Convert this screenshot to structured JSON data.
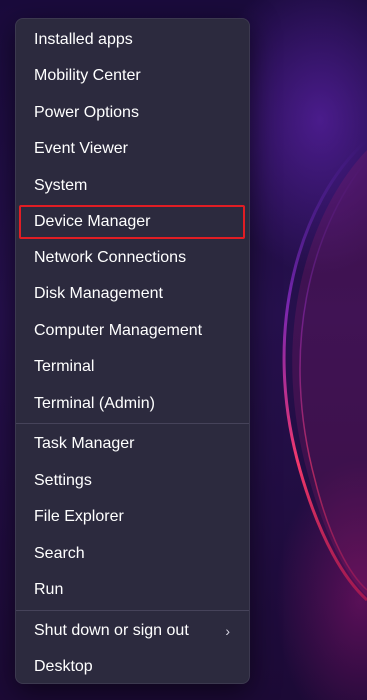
{
  "menu": {
    "group1": [
      {
        "label": "Installed apps"
      },
      {
        "label": "Mobility Center"
      },
      {
        "label": "Power Options"
      },
      {
        "label": "Event Viewer"
      },
      {
        "label": "System"
      },
      {
        "label": "Device Manager"
      },
      {
        "label": "Network Connections"
      },
      {
        "label": "Disk Management"
      },
      {
        "label": "Computer Management"
      },
      {
        "label": "Terminal"
      },
      {
        "label": "Terminal (Admin)"
      }
    ],
    "group2": [
      {
        "label": "Task Manager"
      },
      {
        "label": "Settings"
      },
      {
        "label": "File Explorer"
      },
      {
        "label": "Search"
      },
      {
        "label": "Run"
      }
    ],
    "group3": [
      {
        "label": "Shut down or sign out",
        "submenu_icon": "chevron-right-icon"
      },
      {
        "label": "Desktop"
      }
    ],
    "highlighted_item": "Device Manager",
    "highlight_color": "#e11d24"
  }
}
